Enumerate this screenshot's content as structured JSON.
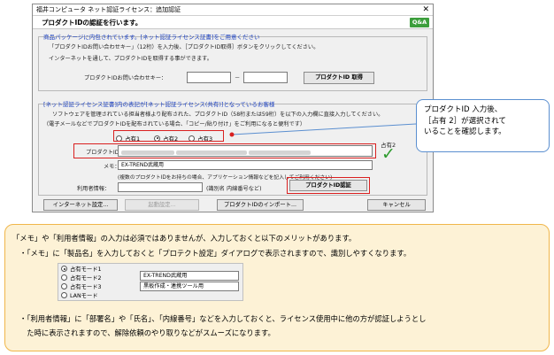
{
  "window": {
    "title": "福井コンピュータ ネット認証ライセンス：追加認証",
    "close_glyph": "✕",
    "heading": "プロダクトIDの認証を行います。",
    "qa_label": "Q&A"
  },
  "package_section": {
    "title": "商品パッケージに内包されています。[ネット認証ライセンス証書]をご用意ください",
    "line1": "「プロダクトIDお問い合わせキー」（12桁）を入力後、［プロダクトID取得］ボタンをクリックしてください。",
    "line2": "インターネットを通して、プロダクトIDを取得する事ができます。",
    "key_label": "プロダクトIDお問い合わせキー：",
    "key_value1": "",
    "key_dash": "－",
    "key_value2": "",
    "get_button": "プロダクトID 取得"
  },
  "shared_section": {
    "title": "[ネット認証ライセンス証書]内の表記が[ネット認証ライセンス(共有)]となっているお客様",
    "line1": "ソフトウェアを管理されている担当者様より配布された、プロダクトID（58桁または59桁）を以下の入力欄に直接入力してください。",
    "line2": "（電子メールなどでプロダクトIDを配布されている場合、「コピー/貼り付け」をご利用になると便利です）",
    "radios": [
      {
        "label": "占有1",
        "checked": false
      },
      {
        "label": "占有2",
        "checked": true
      },
      {
        "label": "占有3",
        "checked": false
      }
    ],
    "product_id_label": "プロダクトID：",
    "occupancy_label": "占有2",
    "check_glyph": "✓",
    "memo_label": "メモ：",
    "memo_value": "EX-TREND武蔵用",
    "memo_hint": "(複数のプロダクトIDをお持ちの場合、アプリケーション情報などを記入してご利用ください)",
    "user_info_label": "利用者情報：",
    "user_info_hint": "(識別名 内線番号など)",
    "auth_button": "プロダクトID認証"
  },
  "footer": {
    "internet_button": "インターネット設定...",
    "startup_button": "起動設定...",
    "import_button": "プロダクトIDのインポート...",
    "cancel_button": "キャンセル"
  },
  "callout": {
    "line1": "プロダクトID 入力後、",
    "line2": "［占有 2］が選択されて",
    "line3": "いることを確認します。"
  },
  "note": {
    "line1": "「メモ」や「利用者情報」の入力は必須ではありませんが、入力しておくと以下のメリットがあります。",
    "line2": "・「メモ」に「製品名」を入力しておくと「プロテクト設定」ダイアログで表示されますので、識別しやすくなります。",
    "example": {
      "radios": [
        {
          "label": "占有モード1",
          "checked": true
        },
        {
          "label": "占有モード2",
          "checked": false
        },
        {
          "label": "占有モード3",
          "checked": false
        },
        {
          "label": "LANモード",
          "checked": false
        }
      ],
      "memo1": "EX-TREND武蔵用",
      "memo2": "黒板作成・連携ツール用"
    },
    "line3": "・「利用者情報」に「部署名」や「氏名」、「内線番号」などを入力しておくと、ライセンス使用中に他の方が認証しようとし",
    "line4": "　た時に表示されますので、解除依頼のやり取りなどがスムーズになります。"
  },
  "colors": {
    "accent_blue": "#1a3fbf",
    "highlight_red": "#d92020",
    "check_green": "#2e9b2e",
    "note_bg": "#fdf2d6",
    "note_border": "#f0b64a",
    "callout_border": "#5b8fd0"
  }
}
